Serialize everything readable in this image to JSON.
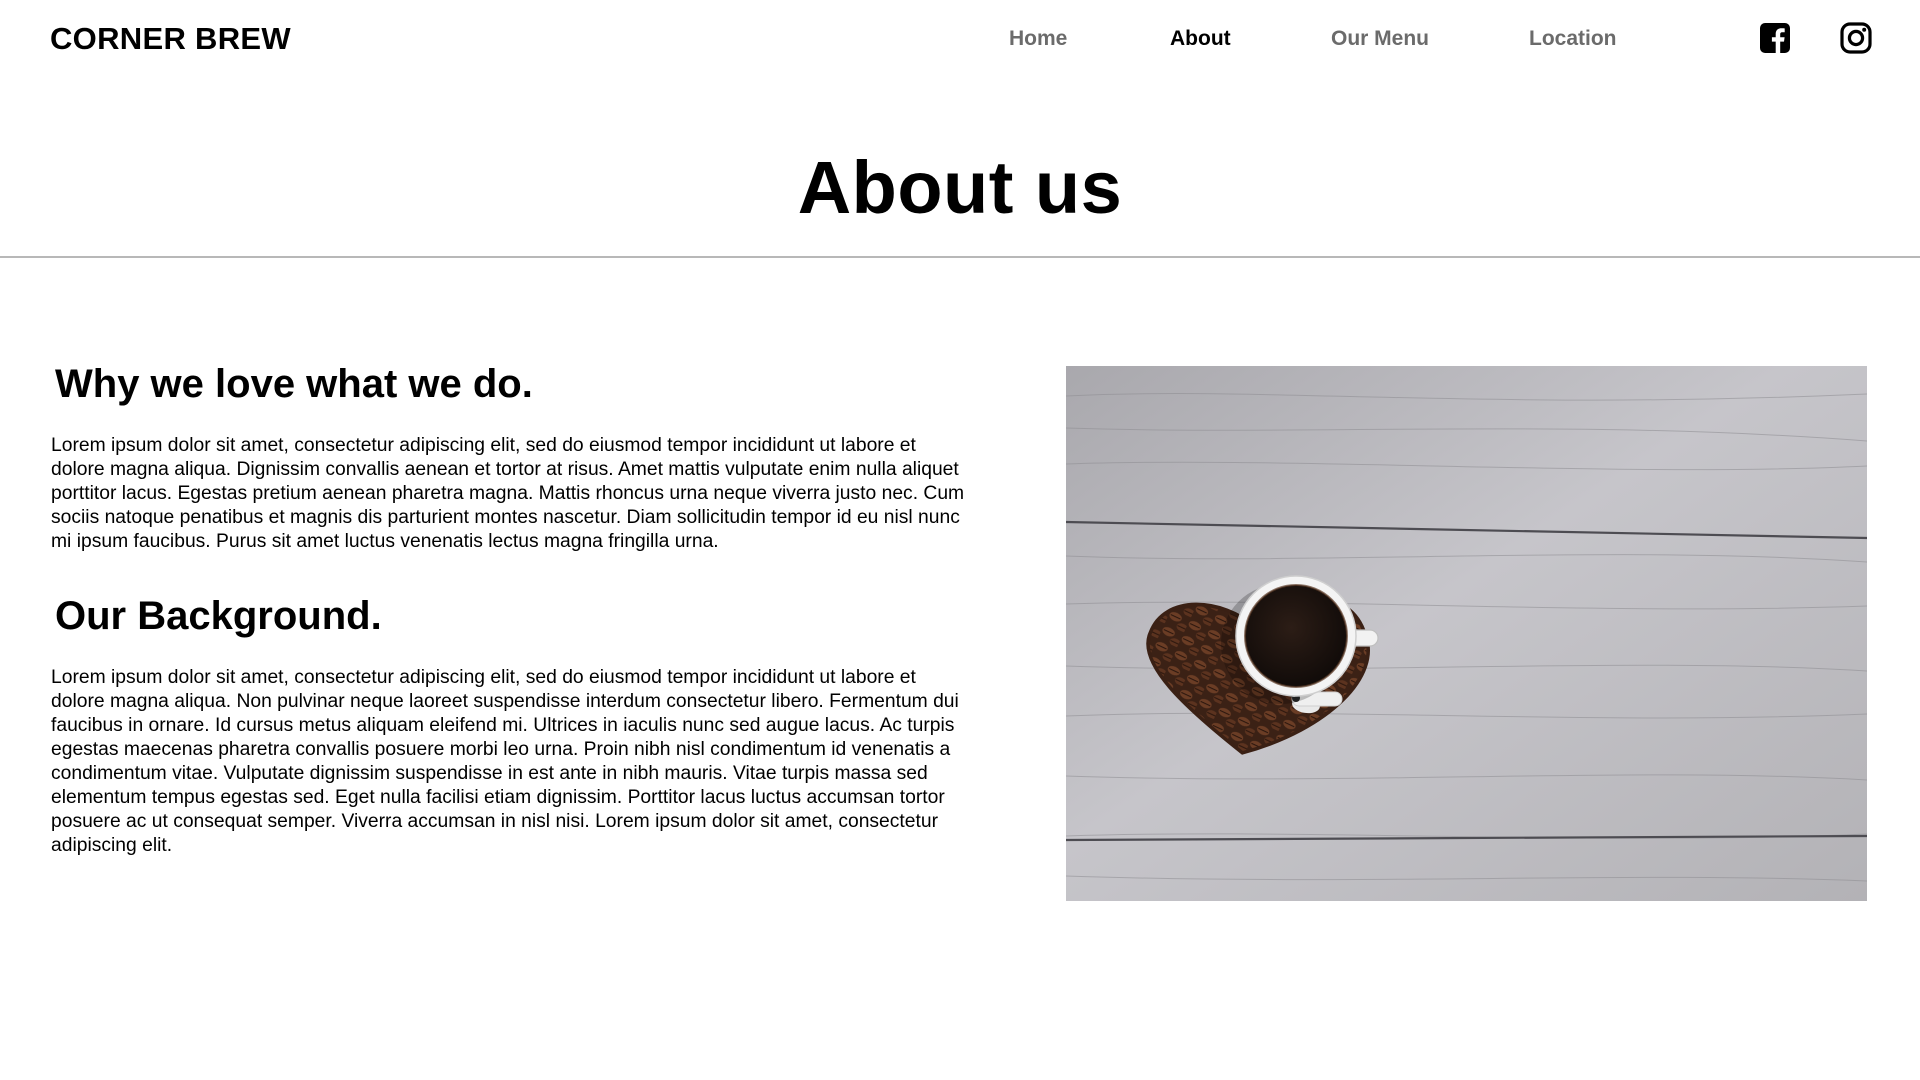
{
  "header": {
    "brand": "CORNER BREW",
    "nav": [
      {
        "label": "Home",
        "active": false
      },
      {
        "label": "About",
        "active": true
      },
      {
        "label": "Our Menu",
        "active": false
      },
      {
        "label": "Location",
        "active": false
      }
    ],
    "social": [
      "facebook-icon",
      "instagram-icon"
    ]
  },
  "page_title": "About us",
  "sections": [
    {
      "heading": "Why we love what we do.",
      "body": "Lorem ipsum dolor sit amet, consectetur adipiscing elit, sed do eiusmod tempor incididunt ut labore et dolore magna aliqua. Dignissim convallis aenean et tortor at risus. Amet mattis vulputate enim nulla aliquet porttitor lacus. Egestas pretium aenean pharetra magna. Mattis rhoncus urna neque viverra justo nec. Cum sociis natoque penatibus et magnis dis parturient montes nascetur. Diam sollicitudin tempor id eu nisl nunc mi ipsum faucibus. Purus sit amet luctus venenatis lectus magna fringilla urna."
    },
    {
      "heading": "Our Background.",
      "body": "Lorem ipsum dolor sit amet, consectetur adipiscing elit, sed do eiusmod tempor incididunt ut labore et dolore magna aliqua. Non pulvinar neque laoreet suspendisse interdum consectetur libero. Fermentum dui faucibus in ornare. Id cursus metus aliquam eleifend mi. Ultrices in iaculis nunc sed augue lacus. Ac turpis egestas maecenas pharetra convallis posuere morbi leo urna. Proin nibh nisl condimentum id venenatis a condimentum vitae. Vulputate dignissim suspendisse in est ante in nibh mauris. Vitae turpis massa sed elementum tempus egestas sed. Eget nulla facilisi etiam dignissim. Porttitor lacus luctus accumsan tortor posuere ac ut consequat semper. Viverra accumsan in nisl nisi. Lorem ipsum dolor sit amet, consectetur adipiscing elit."
    }
  ],
  "photo": {
    "subject": "coffee-cup-on-heart-of-coffee-beans",
    "colors": {
      "wood": "#b9b8bc",
      "bean": "#5a3220",
      "coffee": "#1e1410",
      "cup": "#f4f4f4"
    }
  },
  "colors": {
    "nav_inactive": "#6b6b6b",
    "nav_active": "#000000",
    "divider": "#b8b8b8",
    "text": "#000000"
  }
}
